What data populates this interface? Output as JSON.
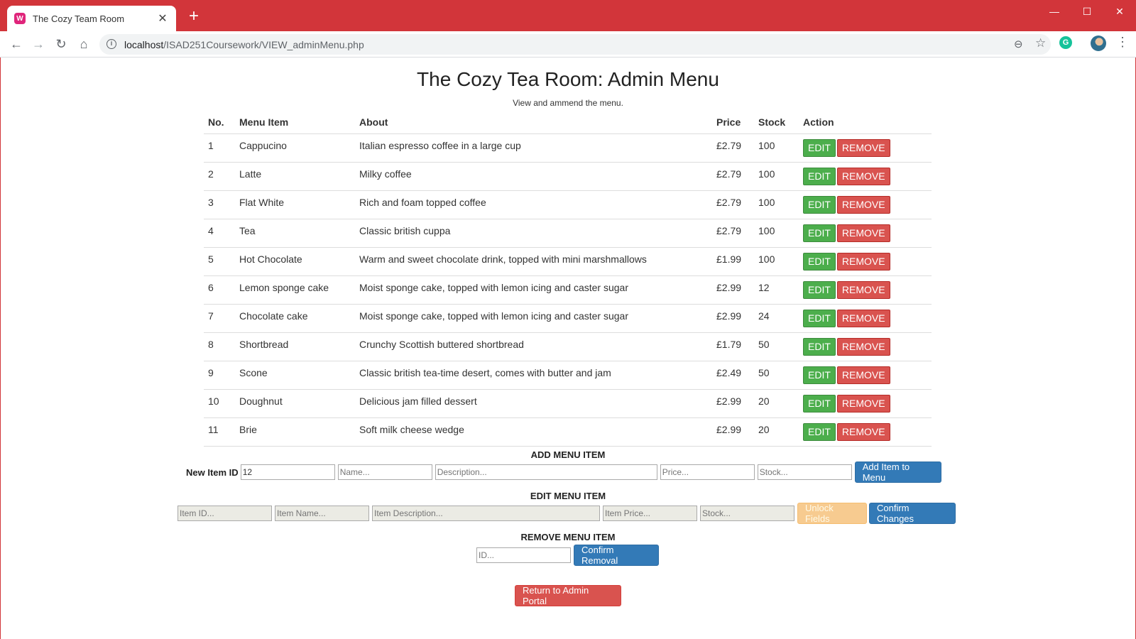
{
  "browser": {
    "tab_title": "The Cozy Team Room",
    "tab_favicon_glyph": "W",
    "new_tab": "+",
    "url_host": "localhost",
    "url_path": "/ISAD251Coursework/VIEW_adminMenu.php",
    "ext_glyph": "G",
    "icons": [
      "back-icon",
      "forward-icon",
      "reload-icon",
      "home-icon",
      "info-icon",
      "zoom-icon",
      "star-icon",
      "extension-icon",
      "avatar",
      "menu-icon"
    ]
  },
  "page": {
    "title": "The Cozy Tea Room: Admin Menu",
    "subtitle": "View and ammend the menu."
  },
  "table": {
    "headers": [
      "No.",
      "Menu Item",
      "About",
      "Price",
      "Stock",
      "Action"
    ],
    "edit_label": "EDIT",
    "remove_label": "REMOVE",
    "rows": [
      {
        "no": "1",
        "item": "Cappucino",
        "about": "Italian espresso coffee in a large cup",
        "price": "£2.79",
        "stock": "100"
      },
      {
        "no": "2",
        "item": "Latte",
        "about": "Milky coffee",
        "price": "£2.79",
        "stock": "100"
      },
      {
        "no": "3",
        "item": "Flat White",
        "about": "Rich and foam topped coffee",
        "price": "£2.79",
        "stock": "100"
      },
      {
        "no": "4",
        "item": "Tea",
        "about": "Classic british cuppa",
        "price": "£2.79",
        "stock": "100"
      },
      {
        "no": "5",
        "item": "Hot Chocolate",
        "about": "Warm and sweet chocolate drink, topped with mini marshmallows",
        "price": "£1.99",
        "stock": "100"
      },
      {
        "no": "6",
        "item": "Lemon sponge cake",
        "about": "Moist sponge cake, topped with lemon icing and caster sugar",
        "price": "£2.99",
        "stock": "12"
      },
      {
        "no": "7",
        "item": "Chocolate cake",
        "about": "Moist sponge cake, topped with lemon icing and caster sugar",
        "price": "£2.99",
        "stock": "24"
      },
      {
        "no": "8",
        "item": "Shortbread",
        "about": "Crunchy Scottish buttered shortbread",
        "price": "£1.79",
        "stock": "50"
      },
      {
        "no": "9",
        "item": "Scone",
        "about": "Classic british tea-time desert, comes with butter and jam",
        "price": "£2.49",
        "stock": "50"
      },
      {
        "no": "10",
        "item": "Doughnut",
        "about": "Delicious jam filled dessert",
        "price": "£2.99",
        "stock": "20"
      },
      {
        "no": "11",
        "item": "Brie",
        "about": "Soft milk cheese wedge",
        "price": "£2.99",
        "stock": "20"
      }
    ]
  },
  "add_form": {
    "title": "ADD MENU ITEM",
    "id_label": "New Item ID",
    "id_value": "12",
    "name_placeholder": "Name...",
    "description_placeholder": "Description...",
    "price_placeholder": "Price...",
    "stock_placeholder": "Stock...",
    "submit_label": "Add Item to Menu"
  },
  "edit_form": {
    "title": "EDIT MENU ITEM",
    "id_placeholder": "Item ID...",
    "name_placeholder": "Item Name...",
    "description_placeholder": "Item Description...",
    "price_placeholder": "Item Price...",
    "stock_placeholder": "Stock...",
    "unlock_label": "Unlock Fields",
    "confirm_label": "Confirm Changes"
  },
  "remove_form": {
    "title": "REMOVE MENU ITEM",
    "id_placeholder": "ID...",
    "confirm_label": "Confirm Removal"
  },
  "return_label": "Return to Admin Portal",
  "colors": {
    "browser_red": "#d2353a",
    "edit_green": "#4cae4c",
    "remove_red": "#d9534f",
    "primary_blue": "#337ab7",
    "warning_orange": "#f7cb90"
  }
}
